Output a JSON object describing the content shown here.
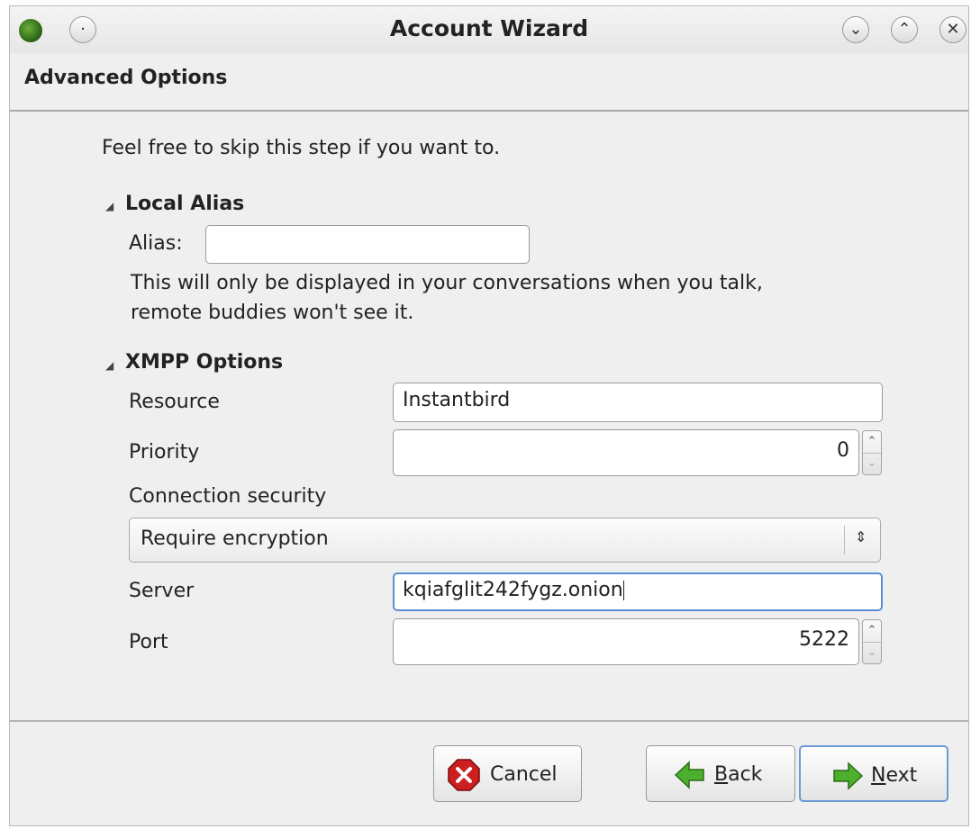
{
  "window": {
    "title": "Account Wizard",
    "section_title": "Advanced Options"
  },
  "titlebar_buttons": {
    "menu_glyph": "·",
    "minimize_glyph": "⌄",
    "maximize_glyph": "⌃",
    "close_glyph": "✕"
  },
  "intro_text": "Feel free to skip this step if you want to.",
  "local_alias": {
    "expander_glyph": "◢",
    "heading": "Local Alias",
    "alias_label": "Alias:",
    "alias_value": "",
    "help_line1": "This will only be displayed in your conversations when you talk,",
    "help_line2": "remote buddies won't see it."
  },
  "xmpp": {
    "expander_glyph": "◢",
    "heading": "XMPP Options",
    "resource_label": "Resource",
    "resource_value": "Instantbird",
    "priority_label": "Priority",
    "priority_value": "0",
    "connection_security_label": "Connection security",
    "connection_security_value": "Require encryption",
    "server_label": "Server",
    "server_value": "kqiafglit242fygz.onion",
    "port_label": "Port",
    "port_value": "5222"
  },
  "buttons": {
    "cancel": "Cancel",
    "back_mnemonic": "B",
    "back_rest": "ack",
    "next_mnemonic": "N",
    "next_rest": "ext"
  },
  "colors": {
    "focus_border": "#5b8fd0",
    "cancel_icon": "#cc1f1f",
    "arrow_icon": "#4caf2e"
  }
}
